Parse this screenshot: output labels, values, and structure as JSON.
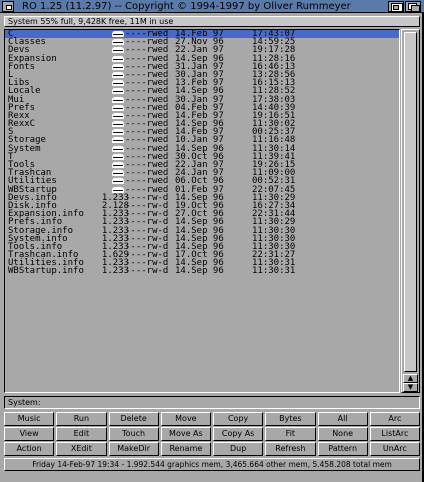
{
  "window": {
    "title": "RO 1.25 (11.2.97) -- Copyright © 1994-1997 by Oliver Rummeyer"
  },
  "status_line": "System 55% full, 9,428K free, 11M in use",
  "files": [
    {
      "name": "C",
      "size": "",
      "prot": "----rwed",
      "date": "14.Feb 97",
      "time": "17:43:07",
      "selected": true
    },
    {
      "name": "Classes",
      "size": "",
      "prot": "----rwed",
      "date": "27.Nov 96",
      "time": "14:59:25"
    },
    {
      "name": "Devs",
      "size": "",
      "prot": "----rwed",
      "date": "22.Jan 97",
      "time": "19:17:28"
    },
    {
      "name": "Expansion",
      "size": "",
      "prot": "----rwed",
      "date": "14.Sep 96",
      "time": "11:28:16"
    },
    {
      "name": "Fonts",
      "size": "",
      "prot": "----rwed",
      "date": "31.Jan 97",
      "time": "16:46:13"
    },
    {
      "name": "L",
      "size": "",
      "prot": "----rwed",
      "date": "30.Jan 97",
      "time": "13:28:56"
    },
    {
      "name": "Libs",
      "size": "",
      "prot": "----rwed",
      "date": "13.Feb 97",
      "time": "16:15:13"
    },
    {
      "name": "Locale",
      "size": "",
      "prot": "----rwed",
      "date": "14.Sep 96",
      "time": "11:28:52"
    },
    {
      "name": "Mui",
      "size": "",
      "prot": "----rwed",
      "date": "30.Jan 97",
      "time": "17:38:03"
    },
    {
      "name": "Prefs",
      "size": "",
      "prot": "----rwed",
      "date": "04.Feb 97",
      "time": "14:40:39"
    },
    {
      "name": "Rexx",
      "size": "",
      "prot": "----rwed",
      "date": "14.Feb 97",
      "time": "19:16:51"
    },
    {
      "name": "RexxC",
      "size": "",
      "prot": "----rwed",
      "date": "14.Sep 96",
      "time": "11:30:02"
    },
    {
      "name": "S",
      "size": "",
      "prot": "----rwed",
      "date": "14.Feb 97",
      "time": "00:25:37"
    },
    {
      "name": "Storage",
      "size": "",
      "prot": "----rwed",
      "date": "10.Jan 97",
      "time": "11:16:48"
    },
    {
      "name": "System",
      "size": "",
      "prot": "----rwed",
      "date": "14.Sep 96",
      "time": "11:30:14"
    },
    {
      "name": "T",
      "size": "",
      "prot": "----rwed",
      "date": "30.Oct 96",
      "time": "11:39:41"
    },
    {
      "name": "Tools",
      "size": "",
      "prot": "----rwed",
      "date": "22.Jan 97",
      "time": "19:26:15"
    },
    {
      "name": "Trashcan",
      "size": "",
      "prot": "----rwed",
      "date": "24.Jan 97",
      "time": "11:09:00"
    },
    {
      "name": "Utilities",
      "size": "",
      "prot": "----rwed",
      "date": "06.Oct 96",
      "time": "00:52:31"
    },
    {
      "name": "WBStartup",
      "size": "",
      "prot": "----rwed",
      "date": "01.Feb 97",
      "time": "22:07:45"
    },
    {
      "name": "Devs.info",
      "size": "1.233",
      "prot": "----rw-d",
      "date": "14.Sep 96",
      "time": "11:30:29"
    },
    {
      "name": "Disk.info",
      "size": "2.128",
      "prot": "----rw-d",
      "date": "19.Oct 96",
      "time": "16:27:34"
    },
    {
      "name": "Expansion.info",
      "size": "1.233",
      "prot": "----rw-d",
      "date": "27.Oct 96",
      "time": "22:31:44"
    },
    {
      "name": "Prefs.info",
      "size": "1.233",
      "prot": "----rw-d",
      "date": "14.Sep 96",
      "time": "11:30:29"
    },
    {
      "name": "Storage.info",
      "size": "1.233",
      "prot": "----rw-d",
      "date": "14.Sep 96",
      "time": "11:30:30"
    },
    {
      "name": "System.info",
      "size": "1.233",
      "prot": "----rw-d",
      "date": "14.Sep 96",
      "time": "11:30:30"
    },
    {
      "name": "Tools.info",
      "size": "1.233",
      "prot": "----rw-d",
      "date": "14.Sep 96",
      "time": "11:30:30"
    },
    {
      "name": "Trashcan.info",
      "size": "1.629",
      "prot": "----rw-d",
      "date": "17.Oct 96",
      "time": "22:31:27"
    },
    {
      "name": "Utilities.info",
      "size": "1.233",
      "prot": "----rw-d",
      "date": "14.Sep 96",
      "time": "11:30:31"
    },
    {
      "name": "WBStartup.info",
      "size": "1.233",
      "prot": "----rw-d",
      "date": "14.Sep 96",
      "time": "11:30:31"
    }
  ],
  "path_field": {
    "value": "System:"
  },
  "buttons": [
    "Music",
    "Run",
    "Delete",
    "Move",
    "Copy",
    "Bytes",
    "All",
    "Arc",
    "View",
    "Edit",
    "Touch",
    "Move As",
    "Copy As",
    "Fit",
    "None",
    "ListArc",
    "Action",
    "XEdit",
    "MakeDir",
    "Rename",
    "Dup",
    "Refresh",
    "Pattern",
    "UnArc"
  ],
  "memory_line": "Friday 14-Feb-97 19:34 - 1.992.544 graphics mem, 3,465.664 other mem, 5.458.208 total mem",
  "scrollbar": {
    "up_arrow": "▲",
    "down_arrow": "▼",
    "visible_fraction": 1.0
  },
  "colors": {
    "titlebar": "#5a7aaa",
    "selection": "#4a6ac8",
    "background": "#a8a8a8"
  }
}
